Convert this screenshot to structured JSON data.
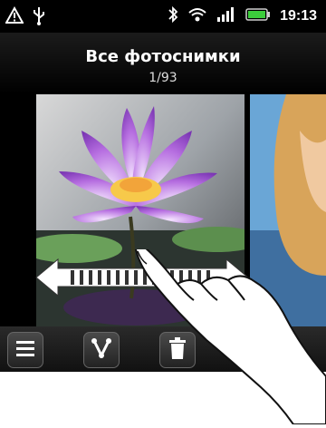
{
  "status": {
    "time": "19:13"
  },
  "header": {
    "title": "Все фотоснимки",
    "counter": "1/93"
  },
  "icons": {
    "warning": "warning-icon",
    "usb": "usb-icon",
    "bluetooth": "bluetooth-icon",
    "wifi": "wifi-icon",
    "signal": "signal-icon",
    "battery": "battery-icon",
    "menu": "menu-icon",
    "share": "share-icon",
    "delete": "trash-icon"
  },
  "colors": {
    "slider_arrow": "#ffffff",
    "accent_lotus": "#a65bd0"
  }
}
